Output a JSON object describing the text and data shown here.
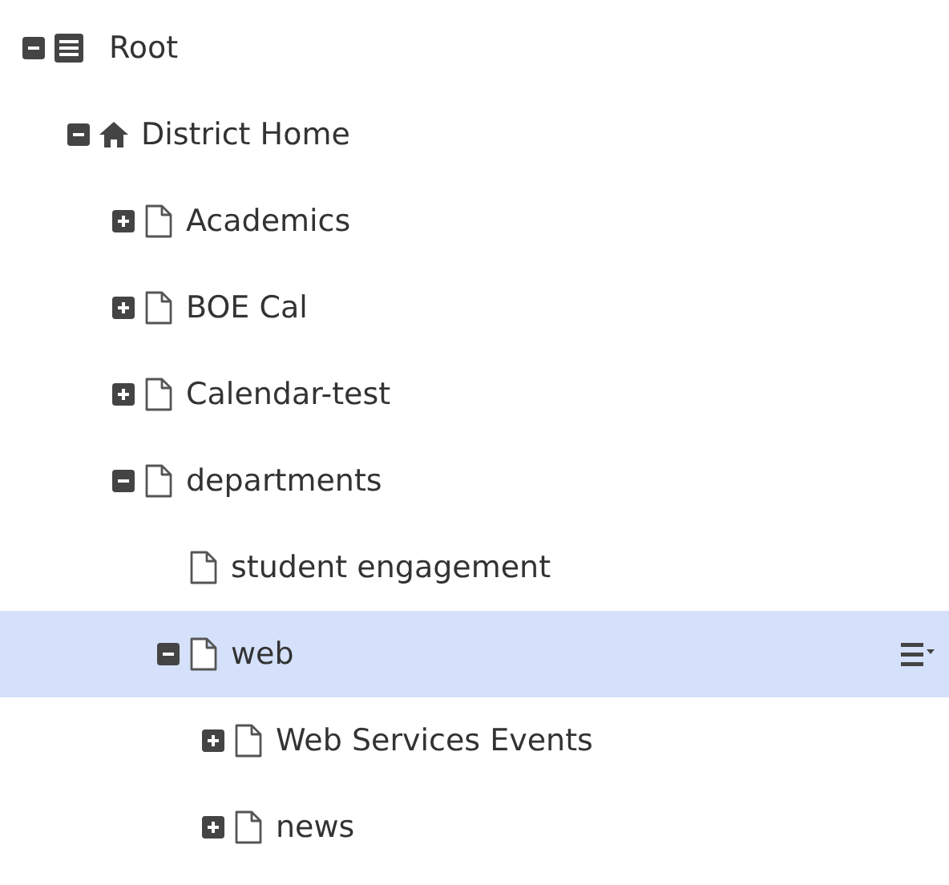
{
  "tree": [
    {
      "label": "Root",
      "kind": "root",
      "expanded": true,
      "selected": false,
      "children": [
        {
          "label": "District Home",
          "kind": "home",
          "expanded": true,
          "selected": false,
          "children": [
            {
              "label": "Academics",
              "kind": "page",
              "expanded": false,
              "selected": false
            },
            {
              "label": "BOE Cal",
              "kind": "page",
              "expanded": false,
              "selected": false
            },
            {
              "label": "Calendar-test",
              "kind": "page",
              "expanded": false,
              "selected": false
            },
            {
              "label": "departments",
              "kind": "page",
              "expanded": true,
              "selected": false,
              "children": [
                {
                  "label": "student engagement",
                  "kind": "page",
                  "selected": false
                },
                {
                  "label": "web",
                  "kind": "page",
                  "expanded": true,
                  "selected": true,
                  "children": [
                    {
                      "label": "Web Services Events",
                      "kind": "page",
                      "expanded": false,
                      "selected": false
                    },
                    {
                      "label": "news",
                      "kind": "page",
                      "expanded": false,
                      "selected": false
                    }
                  ]
                }
              ]
            }
          ]
        }
      ]
    }
  ]
}
